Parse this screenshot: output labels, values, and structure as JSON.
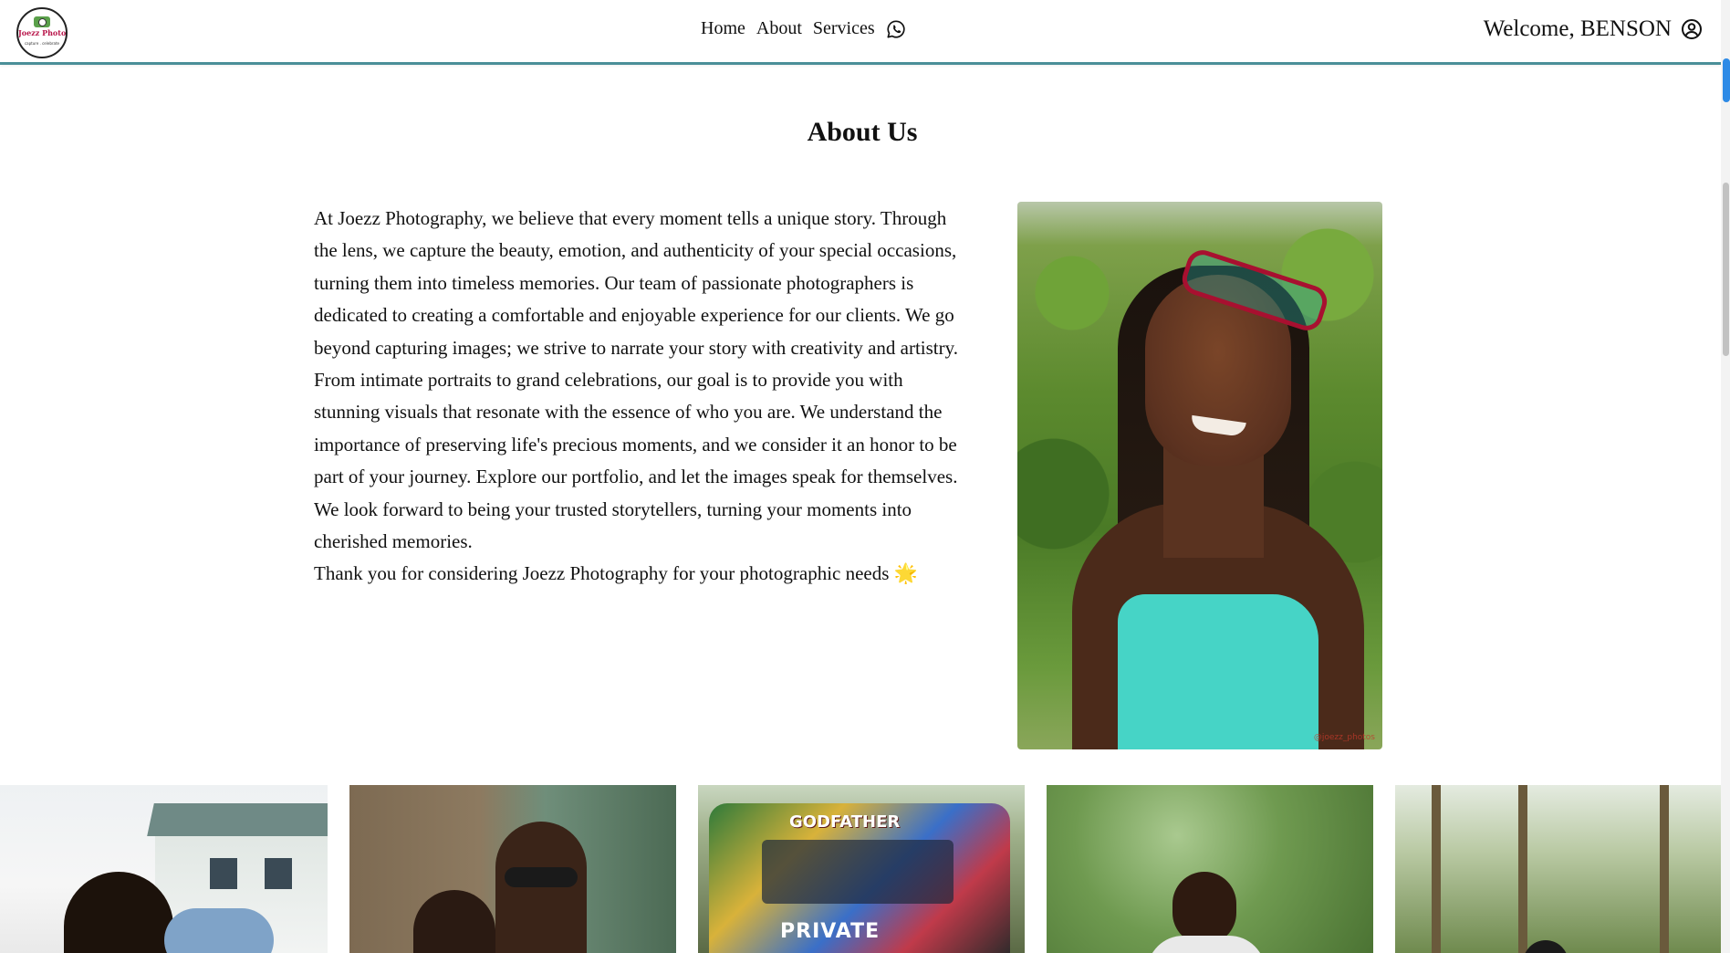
{
  "header": {
    "logo": {
      "text": "Joezz Photography",
      "tagline": "capture . celebrate"
    },
    "nav": {
      "home_label": "Home",
      "about_label": "About",
      "services_label": "Services",
      "whatsapp_icon": "whatsapp-icon"
    },
    "welcome_text": "Welcome, BENSON",
    "user_icon": "user-circle-icon",
    "accent_color": "#4a8f98"
  },
  "about": {
    "title": "About Us",
    "paragraph": "At Joezz Photography, we believe that every moment tells a unique story. Through the lens, we capture the beauty, emotion, and authenticity of your special occasions, turning them into timeless memories. Our team of passionate photographers is dedicated to creating a comfortable and enjoyable experience for our clients. We go beyond capturing images; we strive to narrate your story with creativity and artistry. From intimate portraits to grand celebrations, our goal is to provide you with stunning visuals that resonate with the essence of who you are. We understand the importance of preserving life's precious moments, and we consider it an honor to be part of your journey. Explore our portfolio, and let the images speak for themselves. We look forward to being your trusted storytellers, turning your moments into cherished memories.",
    "thanks": "Thank you for considering Joezz Photography for your photographic needs 🌟",
    "portrait_watermark": "@joezz_photos"
  },
  "gallery": {
    "van_plate": "PRIVATE",
    "van_banner": "GODFATHER"
  },
  "scrollbar": {
    "marker_color": "#2d8ae6"
  }
}
